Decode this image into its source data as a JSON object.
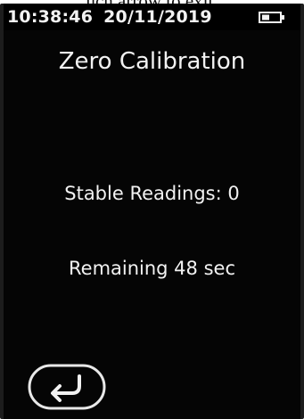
{
  "caption": "uch arrow to exit.",
  "status_bar": {
    "time": "10:38:46",
    "date": "20/11/2019",
    "battery_icon": "battery-icon"
  },
  "screen": {
    "title": "Zero Calibration",
    "stable_readings": "Stable Readings: 0",
    "remaining": "Remaining 48 sec"
  },
  "back_button": {
    "icon": "return-arrow-icon"
  },
  "colors": {
    "screen_background": "#050505",
    "text": "#f2f2f2",
    "bezel": "#1d1d1d"
  }
}
